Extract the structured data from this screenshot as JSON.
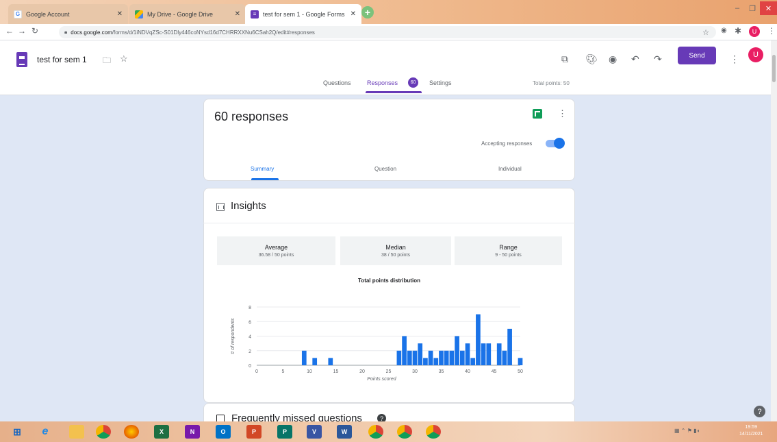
{
  "browser": {
    "tabs": [
      {
        "title": "Google Account",
        "icon": "google-icon"
      },
      {
        "title": "My Drive - Google Drive",
        "icon": "drive-icon"
      },
      {
        "title": "test for sem 1 - Google Forms",
        "icon": "forms-icon"
      }
    ],
    "url_host": "docs.google.com",
    "url_path": "/forms/d/1iNDVqZSc-S01Dly446coNYsd16d7CHRRXXNu6CSah2Q/edit#responses",
    "avatar_letter": "U"
  },
  "form": {
    "title": "test for sem 1",
    "send_label": "Send",
    "avatar_letter": "U",
    "tabs": {
      "questions": "Questions",
      "responses": "Responses",
      "responses_badge": "60",
      "settings": "Settings"
    },
    "total_points": "Total points: 50"
  },
  "responses": {
    "count_label": "60 responses",
    "accepting_label": "Accepting responses",
    "accepting": true,
    "subtabs": {
      "summary": "Summary",
      "question": "Question",
      "individual": "Individual"
    }
  },
  "insights": {
    "title": "Insights",
    "average": {
      "label": "Average",
      "value": "36.58 / 50 points"
    },
    "median": {
      "label": "Median",
      "value": "38 / 50 points"
    },
    "range": {
      "label": "Range",
      "value": "9 - 50 points"
    }
  },
  "chart_data": {
    "type": "bar",
    "title": "Total points distribution",
    "xlabel": "Points scored",
    "ylabel": "# of respondents",
    "xlim": [
      0,
      50
    ],
    "ylim": [
      0,
      8
    ],
    "xticks": [
      0,
      5,
      10,
      15,
      20,
      25,
      30,
      35,
      40,
      45,
      50
    ],
    "yticks": [
      0,
      2,
      4,
      6,
      8
    ],
    "color": "#1a73e8",
    "x": [
      9,
      11,
      14,
      27,
      28,
      29,
      30,
      31,
      32,
      33,
      34,
      35,
      36,
      37,
      38,
      39,
      40,
      41,
      42,
      43,
      44,
      46,
      47,
      48,
      50
    ],
    "values": [
      2,
      1,
      1,
      2,
      4,
      2,
      2,
      3,
      1,
      2,
      1,
      2,
      2,
      2,
      4,
      2,
      3,
      1,
      7,
      3,
      3,
      3,
      2,
      5,
      1
    ]
  },
  "missed": {
    "title": "Frequently missed questions",
    "help": "?"
  },
  "help_button": "?",
  "taskbar": {
    "apps": [
      "windows-start-icon",
      "ie-icon",
      "file-explorer-icon",
      "chrome-icon",
      "firefox-icon",
      "excel-icon",
      "onenote-icon",
      "outlook-icon",
      "powerpoint-icon",
      "publisher-icon",
      "visio-icon",
      "word-icon",
      "chrome-canary-icon",
      "chrome-profile-icon",
      "chrome-profile2-icon"
    ],
    "time": "19:59",
    "date": "14/11/2021"
  }
}
